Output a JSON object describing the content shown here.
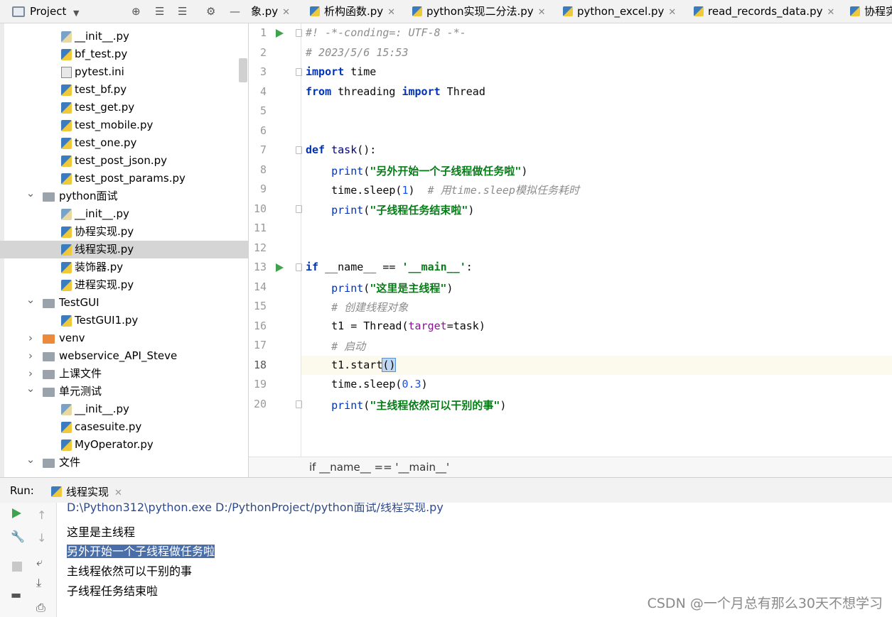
{
  "project_panel": {
    "title": "Project",
    "tree": [
      {
        "label": "__init__.py",
        "icon": "python-file-icon",
        "depth": 2
      },
      {
        "label": "bf_test.py",
        "icon": "python-file-icon",
        "depth": 2
      },
      {
        "label": "pytest.ini",
        "icon": "ini-file-icon",
        "depth": 2
      },
      {
        "label": "test_bf.py",
        "icon": "python-file-icon",
        "depth": 2
      },
      {
        "label": "test_get.py",
        "icon": "python-file-icon",
        "depth": 2
      },
      {
        "label": "test_mobile.py",
        "icon": "python-file-icon",
        "depth": 2
      },
      {
        "label": "test_one.py",
        "icon": "python-file-icon",
        "depth": 2
      },
      {
        "label": "test_post_json.py",
        "icon": "python-file-icon",
        "depth": 2
      },
      {
        "label": "test_post_params.py",
        "icon": "python-file-icon",
        "depth": 2
      },
      {
        "label": "python面试",
        "icon": "folder-icon",
        "depth": 1,
        "expanded": true
      },
      {
        "label": "__init__.py",
        "icon": "python-file-icon",
        "depth": 2
      },
      {
        "label": "协程实现.py",
        "icon": "python-file-icon",
        "depth": 2
      },
      {
        "label": "线程实现.py",
        "icon": "python-file-icon",
        "depth": 2,
        "selected": true
      },
      {
        "label": "装饰器.py",
        "icon": "python-file-icon",
        "depth": 2
      },
      {
        "label": "进程实现.py",
        "icon": "python-file-icon",
        "depth": 2
      },
      {
        "label": "TestGUI",
        "icon": "folder-icon",
        "depth": 1,
        "expanded": true
      },
      {
        "label": "TestGUI1.py",
        "icon": "python-file-icon",
        "depth": 2
      },
      {
        "label": "venv",
        "icon": "folder-orange-icon",
        "depth": 1,
        "expanded": false
      },
      {
        "label": "webservice_API_Steve",
        "icon": "folder-icon",
        "depth": 1,
        "expanded": false
      },
      {
        "label": "上课文件",
        "icon": "folder-icon",
        "depth": 1,
        "expanded": false
      },
      {
        "label": "单元测试",
        "icon": "folder-icon",
        "depth": 1,
        "expanded": true
      },
      {
        "label": "__init__.py",
        "icon": "python-file-icon",
        "depth": 2
      },
      {
        "label": "casesuite.py",
        "icon": "python-file-icon",
        "depth": 2
      },
      {
        "label": "MyOperator.py",
        "icon": "python-file-icon",
        "depth": 2
      },
      {
        "label": "文件",
        "icon": "folder-icon",
        "depth": 1,
        "expanded": true
      }
    ]
  },
  "tabs": [
    {
      "label": "象.py"
    },
    {
      "label": "析构函数.py"
    },
    {
      "label": "python实现二分法.py"
    },
    {
      "label": "python_excel.py"
    },
    {
      "label": "read_records_data.py"
    },
    {
      "label": "协程实"
    }
  ],
  "editor": {
    "lines": [
      {
        "n": "1",
        "html": "<span class='cmt'>#! -*-conding=: UTF-8 -*-</span>"
      },
      {
        "n": "2",
        "html": "<span class='cmt'># 2023/5/6 15:53</span>"
      },
      {
        "n": "3",
        "html": "<span class='kw'>import</span> time"
      },
      {
        "n": "4",
        "html": "<span class='kw'>from</span> threading <span class='kw'>import</span> Thread"
      },
      {
        "n": "5",
        "html": ""
      },
      {
        "n": "6",
        "html": ""
      },
      {
        "n": "7",
        "html": "<span class='kw'>def</span> <span class='fn'>task</span>():"
      },
      {
        "n": "8",
        "html": "    <span class='bl'>print</span>(<span class='str'>\"另外开始一个子线程做任务啦\"</span>)"
      },
      {
        "n": "9",
        "html": "    time.sleep(<span class='num'>1</span>)  <span class='cmt'># 用time.sleep模拟任务耗时</span>"
      },
      {
        "n": "10",
        "html": "    <span class='bl'>print</span>(<span class='str'>\"子线程任务结束啦\"</span>)"
      },
      {
        "n": "11",
        "html": ""
      },
      {
        "n": "12",
        "html": ""
      },
      {
        "n": "13",
        "html": "<span class='kw'>if</span> __name__ == <span class='str'>'__main__'</span>:"
      },
      {
        "n": "14",
        "html": "    <span class='bl'>print</span>(<span class='str'>\"这里是主线程\"</span>)"
      },
      {
        "n": "15",
        "html": "    <span class='cmt'># 创建线程对象</span>"
      },
      {
        "n": "16",
        "html": "    t1 = Thread(<span class='par'>target</span>=task)"
      },
      {
        "n": "17",
        "html": "    <span class='cmt'># 启动</span>"
      },
      {
        "n": "18",
        "html": "    t1.start<span class='brk'>()</span>"
      },
      {
        "n": "19",
        "html": "    time.sleep(<span class='num'>0.3</span>)"
      },
      {
        "n": "20",
        "html": "    <span class='bl'>print</span>(<span class='str'>\"主线程依然可以干别的事\"</span>)"
      }
    ],
    "breadcrumb": "if __name__ == '__main__'"
  },
  "run": {
    "label": "Run:",
    "tab": "线程实现",
    "output": [
      {
        "text": "D:\\Python312\\python.exe D:/PythonProject/python面试/线程实现.py",
        "cls": "cmd"
      },
      {
        "text": "这里是主线程",
        "cls": ""
      },
      {
        "text": "另外开始一个子线程做任务啦",
        "cls": "selout"
      },
      {
        "text": "主线程依然可以干别的事",
        "cls": ""
      },
      {
        "text": "子线程任务结束啦",
        "cls": ""
      }
    ]
  },
  "watermark": "CSDN @一个月总有那么30天不想学习"
}
